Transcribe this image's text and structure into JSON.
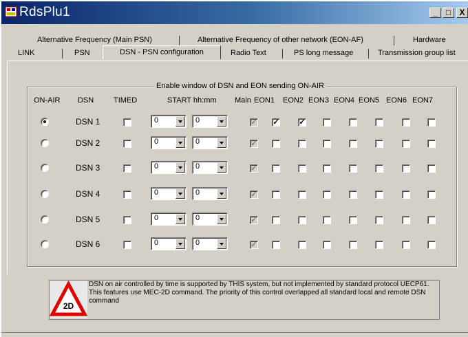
{
  "window": {
    "title": "RdsPlu1",
    "minimize": "_",
    "maximize": "□",
    "close": "X"
  },
  "tabs_row1": [
    {
      "label": "Alternative Frequency (Main PSN)"
    },
    {
      "label": "Alternative Frequency of other network (EON-AF)"
    },
    {
      "label": "Hardware"
    }
  ],
  "tabs_row2": [
    {
      "label": "LINK"
    },
    {
      "label": "PSN"
    },
    {
      "label": "DSN - PSN configuration",
      "active": true
    },
    {
      "label": "Radio Text"
    },
    {
      "label": "PS long message"
    },
    {
      "label": "Transmission group list"
    }
  ],
  "group": {
    "title": "Enable window of DSN and EON sending ON-AIR",
    "headers": {
      "on_air": "ON-AIR",
      "dsn": "DSN",
      "timed": "TIMED",
      "start": "START hh:mm",
      "main": "Main",
      "eon1": "EON1",
      "eon2": "EON2",
      "eon3": "EON3",
      "eon4": "EON4",
      "eon5": "EON5",
      "eon6": "EON6",
      "eon7": "EON7"
    },
    "rows": [
      {
        "dsn": "DSN 1",
        "on_air": true,
        "timed": false,
        "hh": "0",
        "mm": "0",
        "main": true,
        "eon": [
          true,
          true,
          false,
          false,
          false,
          false,
          false
        ]
      },
      {
        "dsn": "DSN 2",
        "on_air": false,
        "timed": false,
        "hh": "0",
        "mm": "0",
        "main": true,
        "eon": [
          false,
          false,
          false,
          false,
          false,
          false,
          false
        ]
      },
      {
        "dsn": "DSN 3",
        "on_air": false,
        "timed": false,
        "hh": "0",
        "mm": "0",
        "main": true,
        "eon": [
          false,
          false,
          false,
          false,
          false,
          false,
          false
        ]
      },
      {
        "dsn": "DSN 4",
        "on_air": false,
        "timed": false,
        "hh": "0",
        "mm": "0",
        "main": true,
        "eon": [
          false,
          false,
          false,
          false,
          false,
          false,
          false
        ]
      },
      {
        "dsn": "DSN 5",
        "on_air": false,
        "timed": false,
        "hh": "0",
        "mm": "0",
        "main": true,
        "eon": [
          false,
          false,
          false,
          false,
          false,
          false,
          false
        ]
      },
      {
        "dsn": "DSN 6",
        "on_air": false,
        "timed": false,
        "hh": "0",
        "mm": "0",
        "main": true,
        "eon": [
          false,
          false,
          false,
          false,
          false,
          false,
          false
        ]
      }
    ]
  },
  "notice": {
    "badge": "2D",
    "text": "DSN on air controlled by time is supported by THIS system, but not implemented by standard protocol UECP61. This features use MEC-2D command. The priority of this control overlapped all standard local and remote DSN command"
  },
  "colors": {
    "face": "#d4d0c8",
    "title_start": "#0a246a",
    "title_end": "#a6caf0",
    "warning_red": "#e00000"
  }
}
